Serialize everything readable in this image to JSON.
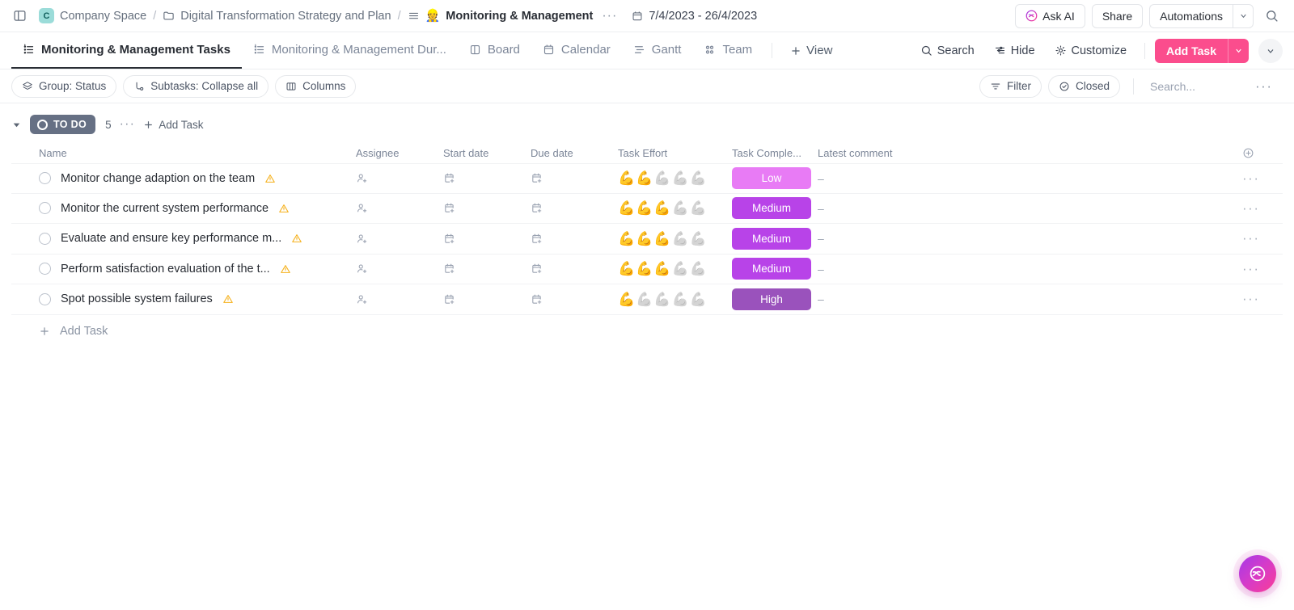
{
  "topbar": {
    "sidebar_toggle_icon": "panel-left-icon",
    "space_initial": "C",
    "space_name": "Company Space",
    "separator": "/",
    "folder_name": "Digital Transformation Strategy and Plan",
    "list_name": "Monitoring & Management",
    "list_emoji": "👷",
    "overflow_dots": "···",
    "date_range": "7/4/2023 - 26/4/2023",
    "ask_ai_label": "Ask AI",
    "share_label": "Share",
    "automations_label": "Automations",
    "search_icon": "search-icon"
  },
  "tabs": [
    {
      "label": "Monitoring & Management Tasks",
      "icon": "list-view-icon",
      "selected": true
    },
    {
      "label": "Monitoring & Management Dur...",
      "icon": "list-view-icon",
      "selected": false
    },
    {
      "label": "Board",
      "icon": "board-icon",
      "selected": false
    },
    {
      "label": "Calendar",
      "icon": "calendar-icon",
      "selected": false
    },
    {
      "label": "Gantt",
      "icon": "gantt-icon",
      "selected": false
    },
    {
      "label": "Team",
      "icon": "team-icon",
      "selected": false
    }
  ],
  "add_view_label": "View",
  "tab_actions": {
    "search_label": "Search",
    "hide_label": "Hide",
    "customize_label": "Customize",
    "add_task_label": "Add Task"
  },
  "toolbar": {
    "group_label": "Group: Status",
    "subtasks_label": "Subtasks: Collapse all",
    "columns_label": "Columns",
    "filter_label": "Filter",
    "closed_label": "Closed",
    "search_placeholder": "Search...",
    "overflow_dots": "···"
  },
  "group": {
    "status_label": "TO DO",
    "count": "5",
    "overflow_dots": "···",
    "add_task_label": "Add Task",
    "status_color": "#667084"
  },
  "columns": {
    "name": "Name",
    "assignee": "Assignee",
    "start_date": "Start date",
    "due_date": "Due date",
    "task_effort": "Task Effort",
    "task_complexity": "Task Comple...",
    "latest_comment": "Latest comment"
  },
  "badge_colors": {
    "Low": "#e87bf5",
    "Medium": "#b843e8",
    "High": "#9a52bc"
  },
  "rows": [
    {
      "title": "Monitor change adaption on the team",
      "effort": 2,
      "effort_max": 5,
      "complexity": "Low",
      "comment": "–"
    },
    {
      "title": "Monitor the current system performance",
      "effort": 3,
      "effort_max": 5,
      "complexity": "Medium",
      "comment": "–"
    },
    {
      "title": "Evaluate and ensure key performance m...",
      "effort": 3,
      "effort_max": 5,
      "complexity": "Medium",
      "comment": "–"
    },
    {
      "title": "Perform satisfaction evaluation of the t...",
      "effort": 3,
      "effort_max": 5,
      "complexity": "Medium",
      "comment": "–"
    },
    {
      "title": "Spot possible system failures",
      "effort": 1,
      "effort_max": 5,
      "complexity": "High",
      "comment": "–"
    }
  ],
  "footer": {
    "add_task_label": "Add Task"
  },
  "fab": {
    "icon": "ai-sparkle-icon"
  }
}
